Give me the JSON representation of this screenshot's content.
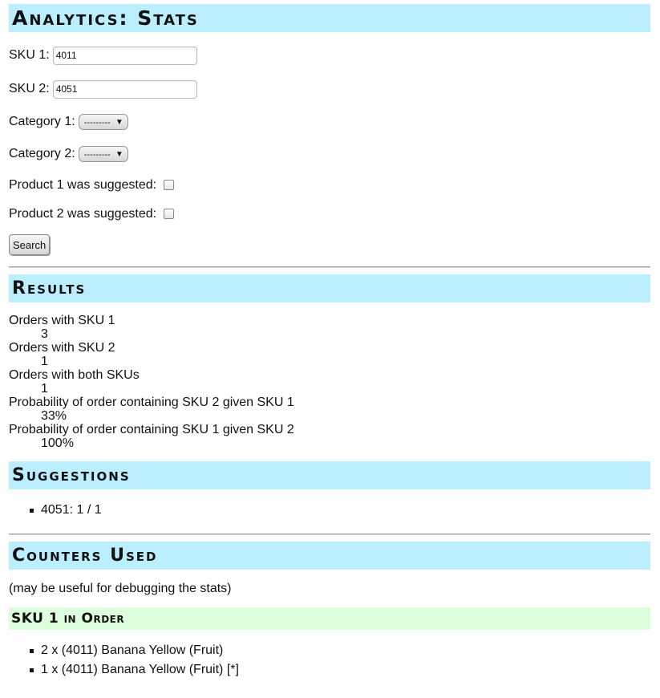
{
  "page_title": "Analytics: Stats",
  "form": {
    "sku1_label": "SKU 1:",
    "sku1_value": "4011",
    "sku2_label": "SKU 2:",
    "sku2_value": "4051",
    "category1_label": "Category 1:",
    "category1_selected": "---------",
    "category2_label": "Category 2:",
    "category2_selected": "---------",
    "product1_suggested_label": "Product 1 was suggested:",
    "product2_suggested_label": "Product 2 was suggested:",
    "search_button": "Search"
  },
  "results": {
    "heading": "Results",
    "rows": [
      {
        "label": "Orders with SKU 1",
        "value": "3"
      },
      {
        "label": "Orders with SKU 2",
        "value": "1"
      },
      {
        "label": "Orders with both SKUs",
        "value": "1"
      },
      {
        "label": "Probability of order containing SKU 2 given SKU 1",
        "value": "33%"
      },
      {
        "label": "Probability of order containing SKU 1 given SKU 2",
        "value": "100%"
      }
    ]
  },
  "suggestions": {
    "heading": "Suggestions",
    "items": [
      "4051: 1 / 1"
    ]
  },
  "counters": {
    "heading": "Counters Used",
    "note": "(may be useful for debugging the stats)",
    "sku1_in_order": {
      "heading": "SKU 1 in Order",
      "items": [
        "2 x (4011) Banana Yellow (Fruit)",
        "1 x (4011) Banana Yellow (Fruit) [*]"
      ]
    }
  }
}
